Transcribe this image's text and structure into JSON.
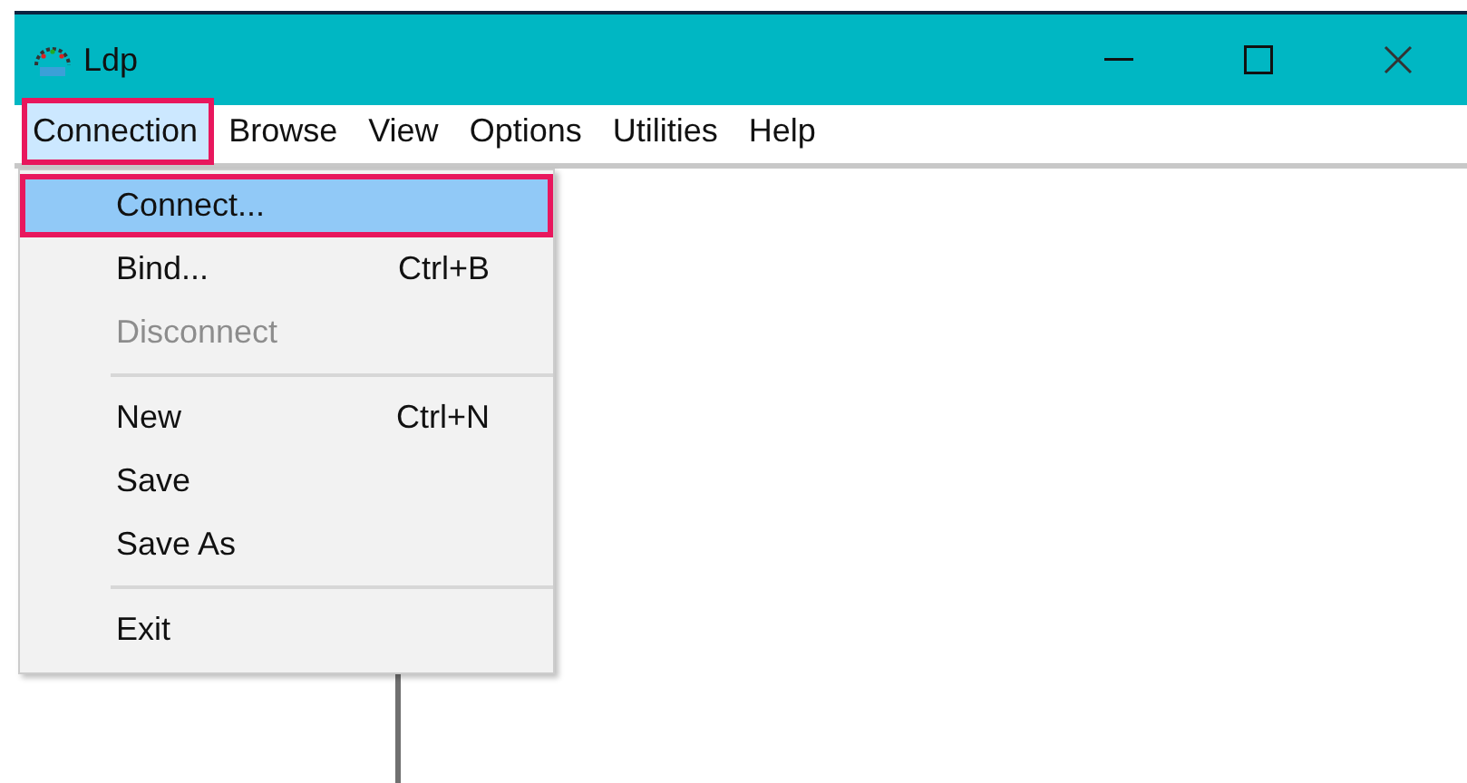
{
  "window": {
    "title": "Ldp"
  },
  "menu_bar": [
    {
      "label": "Connection",
      "selected": true,
      "highlighted": true
    },
    {
      "label": "Browse",
      "selected": false,
      "highlighted": false
    },
    {
      "label": "View",
      "selected": false,
      "highlighted": false
    },
    {
      "label": "Options",
      "selected": false,
      "highlighted": false
    },
    {
      "label": "Utilities",
      "selected": false,
      "highlighted": false
    },
    {
      "label": "Help",
      "selected": false,
      "highlighted": false
    }
  ],
  "dropdown": [
    {
      "kind": "item",
      "label": "Connect...",
      "selected": true,
      "highlighted": true,
      "disabled": false
    },
    {
      "kind": "item",
      "label": "Bind...",
      "shortcut": "Ctrl+B",
      "selected": false,
      "highlighted": false,
      "disabled": false
    },
    {
      "kind": "item",
      "label": "Disconnect",
      "selected": false,
      "highlighted": false,
      "disabled": true
    },
    {
      "kind": "separator"
    },
    {
      "kind": "item",
      "label": "New",
      "shortcut": "Ctrl+N",
      "selected": false,
      "highlighted": false,
      "disabled": false
    },
    {
      "kind": "item",
      "label": "Save",
      "selected": false,
      "highlighted": false,
      "disabled": false
    },
    {
      "kind": "item",
      "label": "Save As",
      "selected": false,
      "highlighted": false,
      "disabled": false
    },
    {
      "kind": "separator"
    },
    {
      "kind": "item",
      "label": "Exit",
      "selected": false,
      "highlighted": false,
      "disabled": false
    }
  ]
}
